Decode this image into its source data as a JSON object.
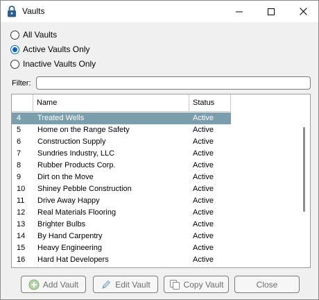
{
  "window": {
    "title": "Vaults",
    "icon": "padlock-icon"
  },
  "filters": {
    "options": [
      {
        "label": "All Vaults",
        "checked": false
      },
      {
        "label": "Active Vaults Only",
        "checked": true
      },
      {
        "label": "Inactive Vaults Only",
        "checked": false
      }
    ],
    "filter_label": "Filter:",
    "filter_value": ""
  },
  "table": {
    "columns": [
      "",
      "Name",
      "Status"
    ],
    "rows": [
      {
        "num": "4",
        "name": "Treated Wells",
        "status": "Active",
        "selected": true
      },
      {
        "num": "5",
        "name": "Home on the Range Safety",
        "status": "Active"
      },
      {
        "num": "6",
        "name": "Construction Supply",
        "status": "Active"
      },
      {
        "num": "7",
        "name": "Sundries Industry, LLC",
        "status": "Active"
      },
      {
        "num": "8",
        "name": "Rubber Products Corp.",
        "status": "Active"
      },
      {
        "num": "9",
        "name": "Dirt on the Move",
        "status": "Active"
      },
      {
        "num": "10",
        "name": "Shiney Pebble Construction",
        "status": "Active"
      },
      {
        "num": "11",
        "name": "Drive Away Happy",
        "status": "Active"
      },
      {
        "num": "12",
        "name": "Real Materials Flooring",
        "status": "Active"
      },
      {
        "num": "13",
        "name": "Brighter Bulbs",
        "status": "Active"
      },
      {
        "num": "14",
        "name": "By Hand Carpentry",
        "status": "Active"
      },
      {
        "num": "15",
        "name": "Heavy Engineering",
        "status": "Active"
      },
      {
        "num": "16",
        "name": "Hard Hat Developers",
        "status": "Active"
      }
    ]
  },
  "buttons": {
    "add": {
      "label": "Add Vault",
      "icon": "plus-circle-icon",
      "enabled": false
    },
    "edit": {
      "label": "Edit Vault",
      "icon": "pencil-icon",
      "enabled": false
    },
    "copy": {
      "label": "Copy Vault",
      "icon": "copy-icon",
      "enabled": false
    },
    "close": {
      "label": "Close",
      "enabled": false
    }
  },
  "colors": {
    "selection": "#7b9ead",
    "radio_accent": "#0067c0",
    "disabled_text": "#6d6d6d"
  }
}
